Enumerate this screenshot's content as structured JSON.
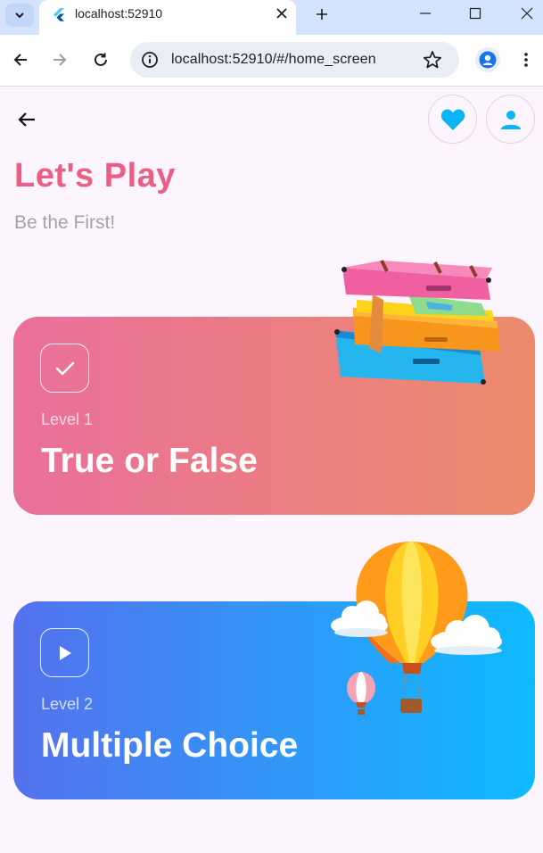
{
  "browser": {
    "tab_title": "localhost:52910",
    "url": "localhost:52910/#/home_screen"
  },
  "header": {
    "title": "Let's Play",
    "subtitle": "Be the First!"
  },
  "levels": [
    {
      "level": "Level 1",
      "title": "True or False",
      "icon": "check-icon"
    },
    {
      "level": "Level 2",
      "title": "Multiple Choice",
      "icon": "play-icon"
    }
  ],
  "colors": {
    "title": "#ec5f84",
    "card1_start": "#ea6f9b",
    "card1_end": "#ec8b6c",
    "card2_start": "#5571ee",
    "card2_end": "#0ebbff",
    "heart": "#0ab4f5"
  }
}
